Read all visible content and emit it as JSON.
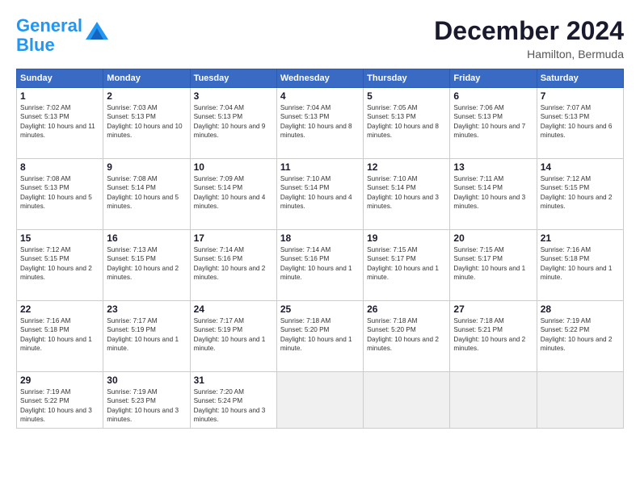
{
  "logo": {
    "line1": "General",
    "line2": "Blue"
  },
  "header": {
    "month": "December 2024",
    "location": "Hamilton, Bermuda"
  },
  "weekdays": [
    "Sunday",
    "Monday",
    "Tuesday",
    "Wednesday",
    "Thursday",
    "Friday",
    "Saturday"
  ],
  "weeks": [
    [
      {
        "day": "1",
        "sunrise": "Sunrise: 7:02 AM",
        "sunset": "Sunset: 5:13 PM",
        "daylight": "Daylight: 10 hours and 11 minutes."
      },
      {
        "day": "2",
        "sunrise": "Sunrise: 7:03 AM",
        "sunset": "Sunset: 5:13 PM",
        "daylight": "Daylight: 10 hours and 10 minutes."
      },
      {
        "day": "3",
        "sunrise": "Sunrise: 7:04 AM",
        "sunset": "Sunset: 5:13 PM",
        "daylight": "Daylight: 10 hours and 9 minutes."
      },
      {
        "day": "4",
        "sunrise": "Sunrise: 7:04 AM",
        "sunset": "Sunset: 5:13 PM",
        "daylight": "Daylight: 10 hours and 8 minutes."
      },
      {
        "day": "5",
        "sunrise": "Sunrise: 7:05 AM",
        "sunset": "Sunset: 5:13 PM",
        "daylight": "Daylight: 10 hours and 8 minutes."
      },
      {
        "day": "6",
        "sunrise": "Sunrise: 7:06 AM",
        "sunset": "Sunset: 5:13 PM",
        "daylight": "Daylight: 10 hours and 7 minutes."
      },
      {
        "day": "7",
        "sunrise": "Sunrise: 7:07 AM",
        "sunset": "Sunset: 5:13 PM",
        "daylight": "Daylight: 10 hours and 6 minutes."
      }
    ],
    [
      {
        "day": "8",
        "sunrise": "Sunrise: 7:08 AM",
        "sunset": "Sunset: 5:13 PM",
        "daylight": "Daylight: 10 hours and 5 minutes."
      },
      {
        "day": "9",
        "sunrise": "Sunrise: 7:08 AM",
        "sunset": "Sunset: 5:14 PM",
        "daylight": "Daylight: 10 hours and 5 minutes."
      },
      {
        "day": "10",
        "sunrise": "Sunrise: 7:09 AM",
        "sunset": "Sunset: 5:14 PM",
        "daylight": "Daylight: 10 hours and 4 minutes."
      },
      {
        "day": "11",
        "sunrise": "Sunrise: 7:10 AM",
        "sunset": "Sunset: 5:14 PM",
        "daylight": "Daylight: 10 hours and 4 minutes."
      },
      {
        "day": "12",
        "sunrise": "Sunrise: 7:10 AM",
        "sunset": "Sunset: 5:14 PM",
        "daylight": "Daylight: 10 hours and 3 minutes."
      },
      {
        "day": "13",
        "sunrise": "Sunrise: 7:11 AM",
        "sunset": "Sunset: 5:14 PM",
        "daylight": "Daylight: 10 hours and 3 minutes."
      },
      {
        "day": "14",
        "sunrise": "Sunrise: 7:12 AM",
        "sunset": "Sunset: 5:15 PM",
        "daylight": "Daylight: 10 hours and 2 minutes."
      }
    ],
    [
      {
        "day": "15",
        "sunrise": "Sunrise: 7:12 AM",
        "sunset": "Sunset: 5:15 PM",
        "daylight": "Daylight: 10 hours and 2 minutes."
      },
      {
        "day": "16",
        "sunrise": "Sunrise: 7:13 AM",
        "sunset": "Sunset: 5:15 PM",
        "daylight": "Daylight: 10 hours and 2 minutes."
      },
      {
        "day": "17",
        "sunrise": "Sunrise: 7:14 AM",
        "sunset": "Sunset: 5:16 PM",
        "daylight": "Daylight: 10 hours and 2 minutes."
      },
      {
        "day": "18",
        "sunrise": "Sunrise: 7:14 AM",
        "sunset": "Sunset: 5:16 PM",
        "daylight": "Daylight: 10 hours and 1 minute."
      },
      {
        "day": "19",
        "sunrise": "Sunrise: 7:15 AM",
        "sunset": "Sunset: 5:17 PM",
        "daylight": "Daylight: 10 hours and 1 minute."
      },
      {
        "day": "20",
        "sunrise": "Sunrise: 7:15 AM",
        "sunset": "Sunset: 5:17 PM",
        "daylight": "Daylight: 10 hours and 1 minute."
      },
      {
        "day": "21",
        "sunrise": "Sunrise: 7:16 AM",
        "sunset": "Sunset: 5:18 PM",
        "daylight": "Daylight: 10 hours and 1 minute."
      }
    ],
    [
      {
        "day": "22",
        "sunrise": "Sunrise: 7:16 AM",
        "sunset": "Sunset: 5:18 PM",
        "daylight": "Daylight: 10 hours and 1 minute."
      },
      {
        "day": "23",
        "sunrise": "Sunrise: 7:17 AM",
        "sunset": "Sunset: 5:19 PM",
        "daylight": "Daylight: 10 hours and 1 minute."
      },
      {
        "day": "24",
        "sunrise": "Sunrise: 7:17 AM",
        "sunset": "Sunset: 5:19 PM",
        "daylight": "Daylight: 10 hours and 1 minute."
      },
      {
        "day": "25",
        "sunrise": "Sunrise: 7:18 AM",
        "sunset": "Sunset: 5:20 PM",
        "daylight": "Daylight: 10 hours and 1 minute."
      },
      {
        "day": "26",
        "sunrise": "Sunrise: 7:18 AM",
        "sunset": "Sunset: 5:20 PM",
        "daylight": "Daylight: 10 hours and 2 minutes."
      },
      {
        "day": "27",
        "sunrise": "Sunrise: 7:18 AM",
        "sunset": "Sunset: 5:21 PM",
        "daylight": "Daylight: 10 hours and 2 minutes."
      },
      {
        "day": "28",
        "sunrise": "Sunrise: 7:19 AM",
        "sunset": "Sunset: 5:22 PM",
        "daylight": "Daylight: 10 hours and 2 minutes."
      }
    ],
    [
      {
        "day": "29",
        "sunrise": "Sunrise: 7:19 AM",
        "sunset": "Sunset: 5:22 PM",
        "daylight": "Daylight: 10 hours and 3 minutes."
      },
      {
        "day": "30",
        "sunrise": "Sunrise: 7:19 AM",
        "sunset": "Sunset: 5:23 PM",
        "daylight": "Daylight: 10 hours and 3 minutes."
      },
      {
        "day": "31",
        "sunrise": "Sunrise: 7:20 AM",
        "sunset": "Sunset: 5:24 PM",
        "daylight": "Daylight: 10 hours and 3 minutes."
      },
      null,
      null,
      null,
      null
    ]
  ]
}
